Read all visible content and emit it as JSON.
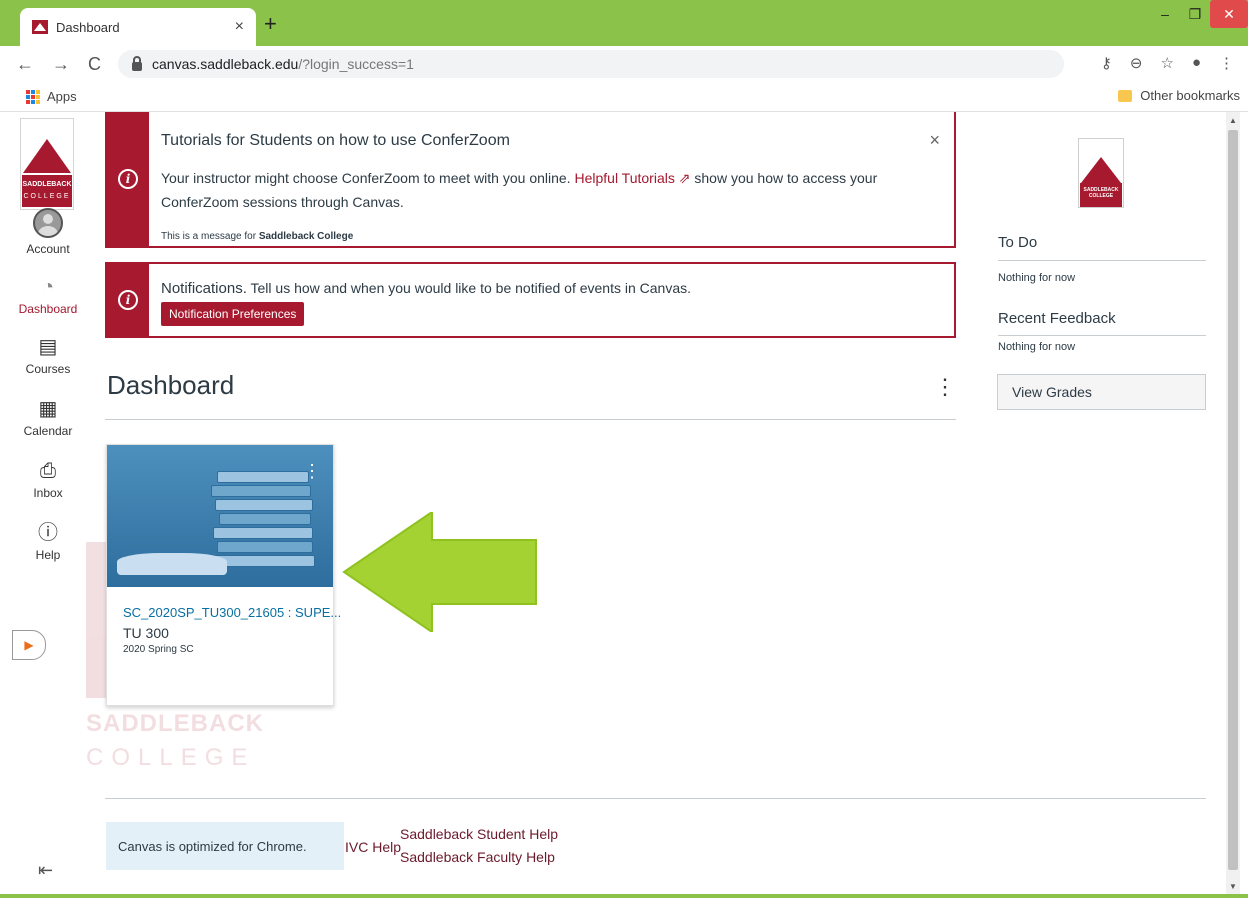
{
  "browser": {
    "tab_title": "Dashboard",
    "tab_close": "×",
    "new_tab": "+",
    "url_host": "canvas.saddleback.edu",
    "url_path": "/?login_success=1",
    "bookmarks_apps": "Apps",
    "other_bookmarks": "Other bookmarks",
    "win_min": "–",
    "win_max": "❐",
    "win_close": "✕"
  },
  "global_nav": {
    "logo_line1": "SADDLEBACK",
    "logo_line2": "COLLEGE",
    "items": [
      {
        "label": "Account"
      },
      {
        "label": "Dashboard"
      },
      {
        "label": "Courses"
      },
      {
        "label": "Calendar"
      },
      {
        "label": "Inbox"
      },
      {
        "label": "Help"
      }
    ]
  },
  "alerts": {
    "tutorial": {
      "title": "Tutorials for Students on how to use ConferZoom",
      "text_before": "Your instructor might choose ConferZoom to meet with you online. ",
      "link": "Helpful Tutorials",
      "text_after": " show you how to access your",
      "line2": "ConferZoom sessions through Canvas.",
      "note_prefix": "This is a message for ",
      "note_org": "Saddleback College",
      "close": "×"
    },
    "notifications": {
      "title": "Notifications.",
      "text": "Tell us how and when you would like to be notified of events in Canvas.",
      "button": "Notification Preferences"
    }
  },
  "dashboard": {
    "title": "Dashboard",
    "menu": "⋮"
  },
  "course_card": {
    "name": "SC_2020SP_TU300_21605 : SUPE...",
    "code": "TU 300",
    "term": "2020 Spring SC",
    "menu": "⋮"
  },
  "sidebar": {
    "logo_text": "SADDLEBACK COLLEGE",
    "todo_title": "To Do",
    "todo_text": "Nothing for now",
    "feedback_title": "Recent Feedback",
    "feedback_text": "Nothing for now",
    "view_grades": "View Grades"
  },
  "footer": {
    "chrome_msg": "Canvas is optimized for Chrome.",
    "ivc_help": "IVC Help",
    "student_help": "Saddleback Student Help",
    "faculty_help": "Saddleback Faculty Help"
  },
  "watermark": {
    "line1": "SADDLEBACK",
    "line2": "COLLEGE"
  },
  "colors": {
    "brand": "#a6192e",
    "link": "#0770a3",
    "frame": "#8bc34a",
    "arrow": "#a4d233"
  }
}
